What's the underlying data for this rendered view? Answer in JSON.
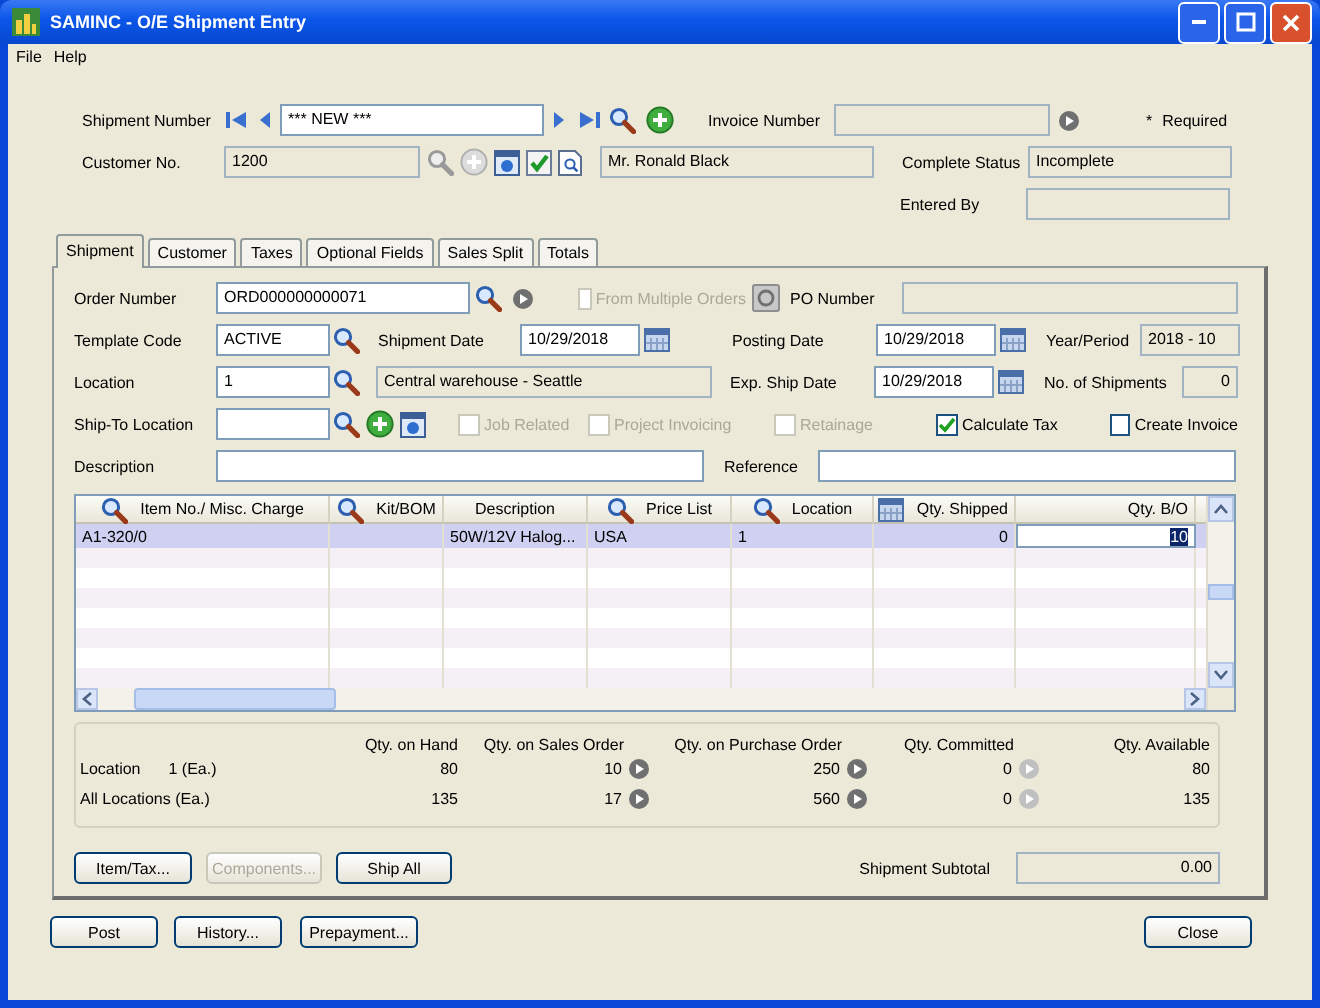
{
  "window": {
    "title": "SAMINC - O/E Shipment Entry"
  },
  "menu": [
    {
      "label": "File"
    },
    {
      "label": "Help"
    }
  ],
  "header": {
    "shipment_number": {
      "label": "Shipment Number",
      "value": "*** NEW ***",
      "editable": true
    },
    "invoice_number": {
      "label": "Invoice Number",
      "editable": false
    },
    "required_mark": "*",
    "required_label": "Required",
    "customer_no": {
      "label": "Customer No.",
      "value": "1200",
      "editable": false
    },
    "customer_name": {
      "value": "Mr. Ronald Black",
      "editable": false
    },
    "complete_status": {
      "label": "Complete Status",
      "value": "Incomplete",
      "editable": false
    },
    "entered_by": {
      "label": "Entered By",
      "editable": false
    }
  },
  "tabs": [
    {
      "label": "Shipment",
      "selected": true
    },
    {
      "label": "Customer",
      "selected": false
    },
    {
      "label": "Taxes",
      "selected": false
    },
    {
      "label": "Optional Fields",
      "selected": false
    },
    {
      "label": "Sales Split",
      "selected": false
    },
    {
      "label": "Totals",
      "selected": false
    }
  ],
  "shipment": {
    "order_number": {
      "label": "Order Number",
      "value": "ORD000000000071",
      "editable": true
    },
    "from_multiple_orders": {
      "label": "From Multiple Orders",
      "checked": false,
      "disabled": true
    },
    "po_number": {
      "label": "PO Number",
      "editable": false
    },
    "template_code": {
      "label": "Template Code",
      "value": "ACTIVE",
      "editable": true
    },
    "shipment_date": {
      "label": "Shipment Date",
      "value": "10/29/2018",
      "editable": true
    },
    "posting_date": {
      "label": "Posting Date",
      "value": "10/29/2018",
      "editable": true
    },
    "year_period": {
      "label": "Year/Period",
      "value": "2018 - 10",
      "editable": false
    },
    "location": {
      "label": "Location",
      "value": "1",
      "editable": true
    },
    "location_description": {
      "value": "Central warehouse - Seattle",
      "editable": false
    },
    "exp_ship_date": {
      "label": "Exp. Ship Date",
      "value": "10/29/2018",
      "editable": true
    },
    "no_of_shipments": {
      "label": "No. of Shipments",
      "value": "0",
      "editable": false
    },
    "ship_to_location": {
      "label": "Ship-To Location",
      "editable": true
    },
    "options": [
      {
        "label": "Job Related",
        "checked": false,
        "disabled": true
      },
      {
        "label": "Project Invoicing",
        "checked": false,
        "disabled": true
      },
      {
        "label": "Retainage",
        "checked": false,
        "disabled": true
      },
      {
        "label": "Calculate Tax",
        "checked": true,
        "disabled": false
      },
      {
        "label": "Create Invoice",
        "checked": false,
        "disabled": false
      }
    ],
    "description": {
      "label": "Description",
      "editable": true
    },
    "reference": {
      "label": "Reference",
      "editable": true
    }
  },
  "grid": {
    "columns": [
      {
        "label": "Item No./ Misc. Charge",
        "kind": "finder",
        "numeric": false
      },
      {
        "label": "Kit/BOM",
        "kind": "finder",
        "numeric": false
      },
      {
        "label": "Description",
        "kind": "plain",
        "numeric": false
      },
      {
        "label": "Price List",
        "kind": "finder",
        "numeric": false
      },
      {
        "label": "Location",
        "kind": "finder",
        "numeric": false
      },
      {
        "label": "Qty. Shipped",
        "kind": "calendar",
        "numeric": true
      },
      {
        "label": "Qty. B/O",
        "kind": "plain",
        "numeric": true
      }
    ],
    "rows": [
      {
        "item": "A1-320/0",
        "description": "50W/12V Halog...",
        "price_list": "USA",
        "location": "1",
        "qty_shipped": "0",
        "qty_bo": "10",
        "selected": true,
        "editing": true
      }
    ]
  },
  "summary": {
    "columns": [
      {
        "label": "Qty. on Hand",
        "kind": "plain"
      },
      {
        "label": "Qty. on Sales Order",
        "kind": "drilldown"
      },
      {
        "label": "Qty. on Purchase Order",
        "kind": "drilldown"
      },
      {
        "label": "Qty. Committed",
        "kind": "inactive"
      },
      {
        "label": "Qty. Available",
        "kind": "plain"
      }
    ],
    "rows": [
      {
        "label": "Location",
        "unit": "1 (Ea.)",
        "values": [
          "80",
          "10",
          "250",
          "0",
          "80"
        ]
      },
      {
        "label": "All Locations (Ea.)",
        "values": [
          "135",
          "17",
          "560",
          "0",
          "135"
        ]
      }
    ]
  },
  "panel_buttons": [
    {
      "label": "Item/Tax...",
      "disabled": false
    },
    {
      "label": "Components...",
      "disabled": true
    },
    {
      "label": "Ship All",
      "disabled": false
    }
  ],
  "subtotal": {
    "label": "Shipment Subtotal",
    "value": "0.00",
    "editable": false
  },
  "buttons": [
    {
      "label": "Post"
    },
    {
      "label": "History..."
    },
    {
      "label": "Prepayment..."
    },
    {
      "label": "Close"
    }
  ]
}
